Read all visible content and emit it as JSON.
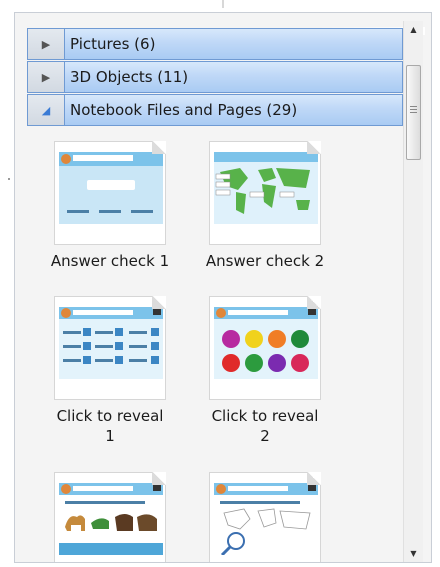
{
  "panel": {
    "sections": [
      {
        "label": "Pictures (6)",
        "state": "collapsed"
      },
      {
        "label": "3D Objects (11)",
        "state": "collapsed"
      },
      {
        "label": "Notebook Files and Pages (29)",
        "state": "expanded"
      }
    ]
  },
  "items": [
    {
      "caption": "Answer check 1",
      "thumbnail": "answer-check-page-thumbnail"
    },
    {
      "caption": "Answer check 2",
      "thumbnail": "world-map-page-thumbnail"
    },
    {
      "caption": "Click to reveal\n1",
      "thumbnail": "number-boxes-page-thumbnail"
    },
    {
      "caption": "Click to reveal\n2",
      "thumbnail": "colored-circles-page-thumbnail"
    },
    {
      "caption": "",
      "thumbnail": "animals-page-thumbnail"
    },
    {
      "caption": "",
      "thumbnail": "outline-map-page-thumbnail"
    }
  ],
  "icons": {
    "collapsed": "triangle-right-icon",
    "expanded": "triangle-down-icon",
    "scroll_up": "arrow-up-icon",
    "scroll_down": "arrow-down-icon"
  },
  "colors": {
    "header_blue": "#bfd8f7",
    "header_border": "#6f9ad3",
    "expanded_arrow": "#3a7bd5"
  }
}
